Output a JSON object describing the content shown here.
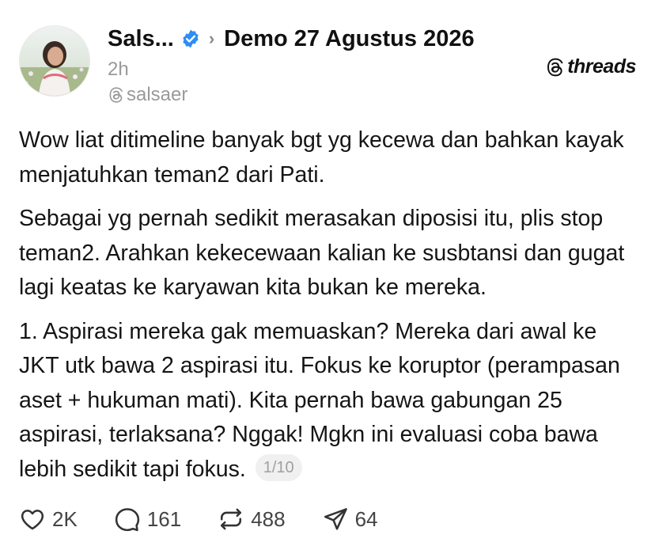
{
  "author": {
    "display_name": "Sals...",
    "handle": "salsaer",
    "time_ago": "2h",
    "verified": true,
    "verified_color": "#2f8cf5"
  },
  "topic": "Demo 27 Agustus 2026",
  "brand": "threads",
  "post": {
    "paragraphs": [
      "Wow liat ditimeline banyak bgt yg kecewa dan bahkan kayak menjatuhkan teman2 dari Pati.",
      "Sebagai yg pernah sedikit merasakan diposisi itu, plis stop teman2. Arahkan kekecewaan kalian ke susbtansi dan gugat lagi keatas ke karyawan kita bukan ke mereka.",
      "1. Aspirasi mereka gak memuaskan? Mereka dari awal ke JKT utk bawa 2 aspirasi itu. Fokus ke koruptor (perampasan aset + hukuman mati). Kita pernah bawa gabungan 25 aspirasi, terlaksana? Nggak! Mgkn ini evaluasi coba bawa lebih sedikit tapi fokus."
    ],
    "page_indicator": "1/10"
  },
  "actions": {
    "likes": "2K",
    "replies": "161",
    "reposts": "488",
    "shares": "64"
  }
}
